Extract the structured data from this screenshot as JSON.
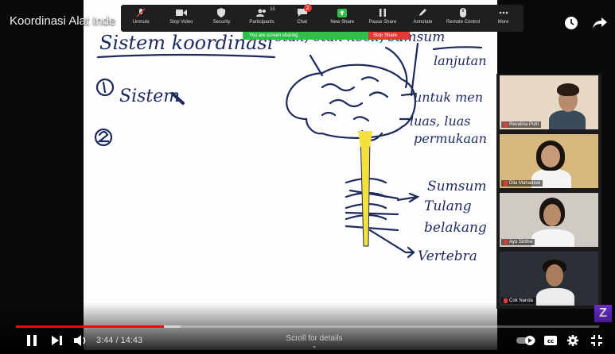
{
  "video": {
    "title": "Koordinasi Alat Inde",
    "time_current": "3:44",
    "time_separator": " / ",
    "time_total": "14:43",
    "scroll_hint": "Scroll for details",
    "played_fraction": 0.254,
    "loaded_fraction": 0.283
  },
  "zoom_toolbar": {
    "items": [
      {
        "label": "Unmute",
        "icon": "mic-muted-icon"
      },
      {
        "label": "Stop Video",
        "icon": "video-camera-icon"
      },
      {
        "label": "Security",
        "icon": "shield-icon"
      },
      {
        "label": "Participants",
        "icon": "participants-icon",
        "count": "15"
      },
      {
        "label": "Chat",
        "icon": "chat-icon",
        "badge": "2"
      },
      {
        "label": "New Share",
        "icon": "share-screen-icon"
      },
      {
        "label": "Pause Share",
        "icon": "pause-icon"
      },
      {
        "label": "Annotate",
        "icon": "pen-icon"
      },
      {
        "label": "Remote Control",
        "icon": "mouse-icon"
      },
      {
        "label": "More",
        "icon": "more-dots-icon"
      }
    ],
    "sharing_text": "You are screen sharing",
    "stop_share": "Stop Share"
  },
  "participants": [
    {
      "name": "Revalina Putri"
    },
    {
      "name": "Dila Mahadewi"
    },
    {
      "name": "Ayu Sintha"
    },
    {
      "name": "Cok Nanda"
    }
  ],
  "whiteboard": {
    "heading": "Sistem koordinasi",
    "item1": "Sistem",
    "item2_number": "2",
    "brain_label": "otak, otak kecil, sumsum",
    "brain_label2": "lanjutan",
    "right_note1": "untuk men",
    "right_note2": "luas, luas",
    "right_note3": "permukaan",
    "spine1": "Sumsum",
    "spine2": "Tulang",
    "spine3": "belakang",
    "spine4": "Vertebra"
  },
  "logo_letter": "Z",
  "colors": {
    "progress": "#ff0000",
    "zoom_green": "#2fbf4b",
    "zoom_red": "#e53935",
    "ink": "#1d2a5c",
    "spine": "#f4e13a"
  }
}
